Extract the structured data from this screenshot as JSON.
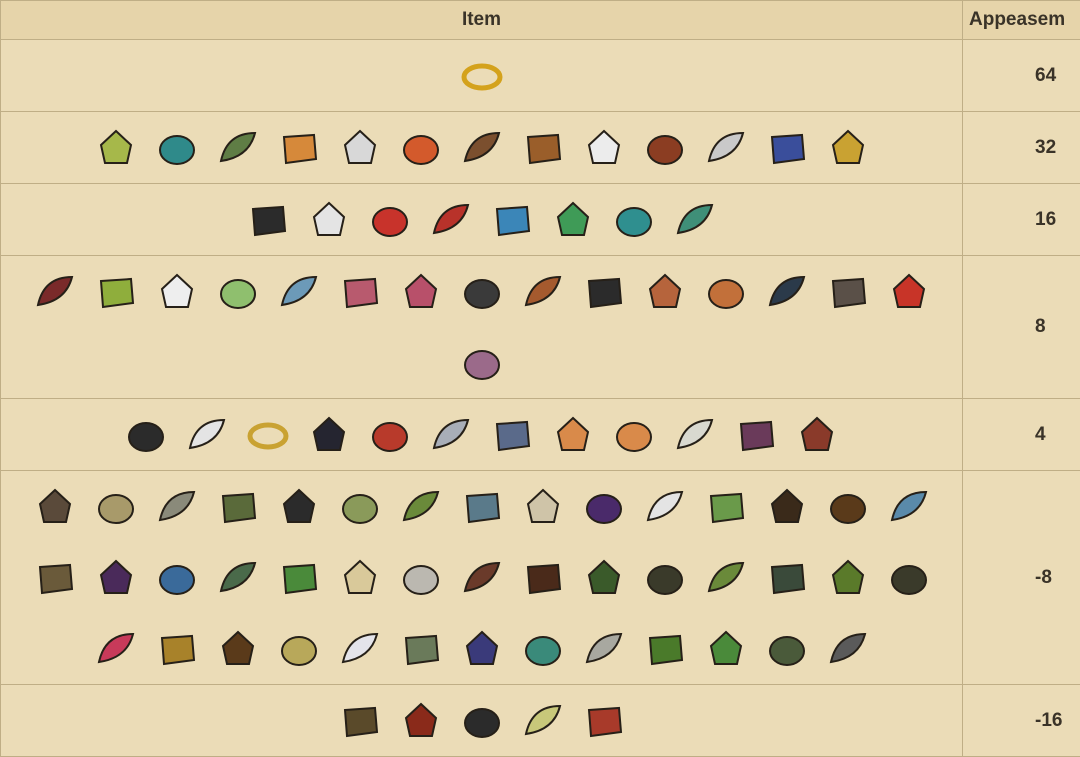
{
  "table": {
    "headers": {
      "item": "Item",
      "appeasement": "Appeasem"
    },
    "rows": [
      {
        "value": "64",
        "items": [
          {
            "icon": "gold-ring-icon",
            "color": "#d4a21c"
          }
        ]
      },
      {
        "value": "32",
        "items": [
          {
            "icon": "bird-figurine-icon",
            "color": "#a6b84a"
          },
          {
            "icon": "feather-fan-icon",
            "color": "#2f8a8a"
          },
          {
            "icon": "ferny-creature-icon",
            "color": "#5f7d45"
          },
          {
            "icon": "treasure-map-icon",
            "color": "#d6893a"
          },
          {
            "icon": "pearl-coin-icon",
            "color": "#d8d8d8"
          },
          {
            "icon": "soda-can-icon",
            "color": "#d35a2c"
          },
          {
            "icon": "voodoo-doll-icon",
            "color": "#7b4f2e"
          },
          {
            "icon": "ukulele-icon",
            "color": "#9a5e2a"
          },
          {
            "icon": "license-plate-icon",
            "color": "#ececec"
          },
          {
            "icon": "vase-icon",
            "color": "#8b3d22"
          },
          {
            "icon": "pebble-icon",
            "color": "#c9c9c9"
          },
          {
            "icon": "toy-boat-icon",
            "color": "#3a4e9b"
          },
          {
            "icon": "gold-bars-icon",
            "color": "#c9a232"
          }
        ]
      },
      {
        "value": "16",
        "items": [
          {
            "icon": "toucan-icon",
            "color": "#2b2b2b"
          },
          {
            "icon": "seagull-icon",
            "color": "#e4e4e4"
          },
          {
            "icon": "parrot-icon",
            "color": "#c8332b"
          },
          {
            "icon": "pirate-parrot-icon",
            "color": "#b8322a"
          },
          {
            "icon": "crab-icon",
            "color": "#3b86b8"
          },
          {
            "icon": "green-egg-icon",
            "color": "#3f9b57"
          },
          {
            "icon": "teal-egg-icon",
            "color": "#2f8f8f"
          },
          {
            "icon": "hatchling-icon",
            "color": "#3f8f78"
          }
        ]
      },
      {
        "value": "8",
        "items": [
          {
            "icon": "butterfly-icon",
            "color": "#7a2a2a"
          },
          {
            "icon": "green-fish-icon",
            "color": "#8fae3c"
          },
          {
            "icon": "white-egg-icon",
            "color": "#eeeeee"
          },
          {
            "icon": "seaweed-icon",
            "color": "#8fbf6e"
          },
          {
            "icon": "swordfish-icon",
            "color": "#6c9ab8"
          },
          {
            "icon": "pink-fish-icon",
            "color": "#b85a6e"
          },
          {
            "icon": "raw-steak-icon",
            "color": "#b8506a"
          },
          {
            "icon": "eel-icon",
            "color": "#3a3a3a"
          },
          {
            "icon": "drumstick-icon",
            "color": "#a55a2e"
          },
          {
            "icon": "small-toucan-icon",
            "color": "#2b2b2b"
          },
          {
            "icon": "cooked-meat-icon",
            "color": "#b6643c"
          },
          {
            "icon": "sweet-potato-icon",
            "color": "#c2703a"
          },
          {
            "icon": "mussel-icon",
            "color": "#2b3a4a"
          },
          {
            "icon": "swirl-icon",
            "color": "#5a5048"
          },
          {
            "icon": "shark-fin-icon",
            "color": "#c83428"
          },
          {
            "icon": "mushroom-cluster-icon",
            "color": "#9b6a8a"
          }
        ]
      },
      {
        "value": "4",
        "items": [
          {
            "icon": "black-seaweed-icon",
            "color": "#2b2b2b"
          },
          {
            "icon": "white-feather-icon",
            "color": "#e4e4e4"
          },
          {
            "icon": "gold-rings-icon",
            "color": "#c9a232"
          },
          {
            "icon": "dark-feather-icon",
            "color": "#252530"
          },
          {
            "icon": "red-feather-icon",
            "color": "#b83a2b"
          },
          {
            "icon": "gray-feather-icon",
            "color": "#a8aeb8"
          },
          {
            "icon": "blue-fish-icon",
            "color": "#5a6a8a"
          },
          {
            "icon": "jellyfish-icon",
            "color": "#d98a4a"
          },
          {
            "icon": "orange-shell-icon",
            "color": "#d98a4a"
          },
          {
            "icon": "rock-pile-icon",
            "color": "#d9d9d0"
          },
          {
            "icon": "purple-mushroom-icon",
            "color": "#6a3a5a"
          },
          {
            "icon": "scrap-pile-icon",
            "color": "#8a3a2a"
          }
        ]
      },
      {
        "value": "-8",
        "items": [
          {
            "icon": "bundle-icon",
            "color": "#5a4a3a"
          },
          {
            "icon": "woven-basket-icon",
            "color": "#a89a6a"
          },
          {
            "icon": "gravel-icon",
            "color": "#8a8a7a"
          },
          {
            "icon": "log-icon",
            "color": "#5a6a3a"
          },
          {
            "icon": "charcoal-icon",
            "color": "#2b2b2b"
          },
          {
            "icon": "grass-tuft-icon",
            "color": "#8a9a5a"
          },
          {
            "icon": "bowtie-grass-icon",
            "color": "#6a8a3a"
          },
          {
            "icon": "blue-rock-icon",
            "color": "#5a7a8a"
          },
          {
            "icon": "flint-icon",
            "color": "#cfc4a8"
          },
          {
            "icon": "berry-bush-icon",
            "color": "#4a2a6a"
          },
          {
            "icon": "white-mound-icon",
            "color": "#e4e4e4"
          },
          {
            "icon": "bamboo-icon",
            "color": "#6a9a4a"
          },
          {
            "icon": "twig-icon",
            "color": "#3a2a1a"
          },
          {
            "icon": "pinecone-icon",
            "color": "#5a3a1a"
          },
          {
            "icon": "coral-icon",
            "color": "#5a8aaa"
          },
          {
            "icon": "stump-icon",
            "color": "#6a5a3a"
          },
          {
            "icon": "dark-berry-icon",
            "color": "#4a2a5a"
          },
          {
            "icon": "gem-cluster-icon",
            "color": "#3a6a9a"
          },
          {
            "icon": "ore-chunk-icon",
            "color": "#4a6a4a"
          },
          {
            "icon": "leaf-icon",
            "color": "#4a8a3a"
          },
          {
            "icon": "papyrus-icon",
            "color": "#d9c99a"
          },
          {
            "icon": "bone-shards-icon",
            "color": "#bbb8b0"
          },
          {
            "icon": "ash-pile-icon",
            "color": "#6a3a2a"
          },
          {
            "icon": "hedgehog-icon",
            "color": "#4a2a1a"
          },
          {
            "icon": "green-foliage-icon",
            "color": "#3a5a2a"
          },
          {
            "icon": "dark-coral-icon",
            "color": "#3a3a2a"
          },
          {
            "icon": "tall-grass-icon",
            "color": "#6a8a3a"
          },
          {
            "icon": "vine-icon",
            "color": "#3a4a3a"
          },
          {
            "icon": "bamboo-bundle-icon",
            "color": "#5a7a2a"
          },
          {
            "icon": "dry-branch-icon",
            "color": "#3a3a2a"
          },
          {
            "icon": "dragon-fruit-icon",
            "color": "#c83a5a"
          },
          {
            "icon": "spiky-seed-icon",
            "color": "#a8822a"
          },
          {
            "icon": "manure-icon",
            "color": "#5a3a1a"
          },
          {
            "icon": "rope-coil-icon",
            "color": "#b8a85a"
          },
          {
            "icon": "snow-pile-icon",
            "color": "#e4e4ea"
          },
          {
            "icon": "moss-patch-icon",
            "color": "#6a7a5a"
          },
          {
            "icon": "starry-leaf-icon",
            "color": "#3a3a7a"
          },
          {
            "icon": "green-tile-icon",
            "color": "#3a8a7a"
          },
          {
            "icon": "branch-icon",
            "color": "#a8a8a0"
          },
          {
            "icon": "mace-icon",
            "color": "#4a7a2a"
          },
          {
            "icon": "cucumber-icon",
            "color": "#4a8a3a"
          },
          {
            "icon": "thatch-icon",
            "color": "#4a5a3a"
          },
          {
            "icon": "spike-crown-icon",
            "color": "#5a5a5a"
          }
        ]
      },
      {
        "value": "-16",
        "items": [
          {
            "icon": "bomb-icon",
            "color": "#5a4a2a"
          },
          {
            "icon": "boiling-pot-icon",
            "color": "#8a2a1a"
          },
          {
            "icon": "coal-pile-icon",
            "color": "#2b2b2b"
          },
          {
            "icon": "yellow-pile-icon",
            "color": "#c8c87a"
          },
          {
            "icon": "red-chunks-icon",
            "color": "#a83a2a"
          }
        ]
      }
    ]
  }
}
